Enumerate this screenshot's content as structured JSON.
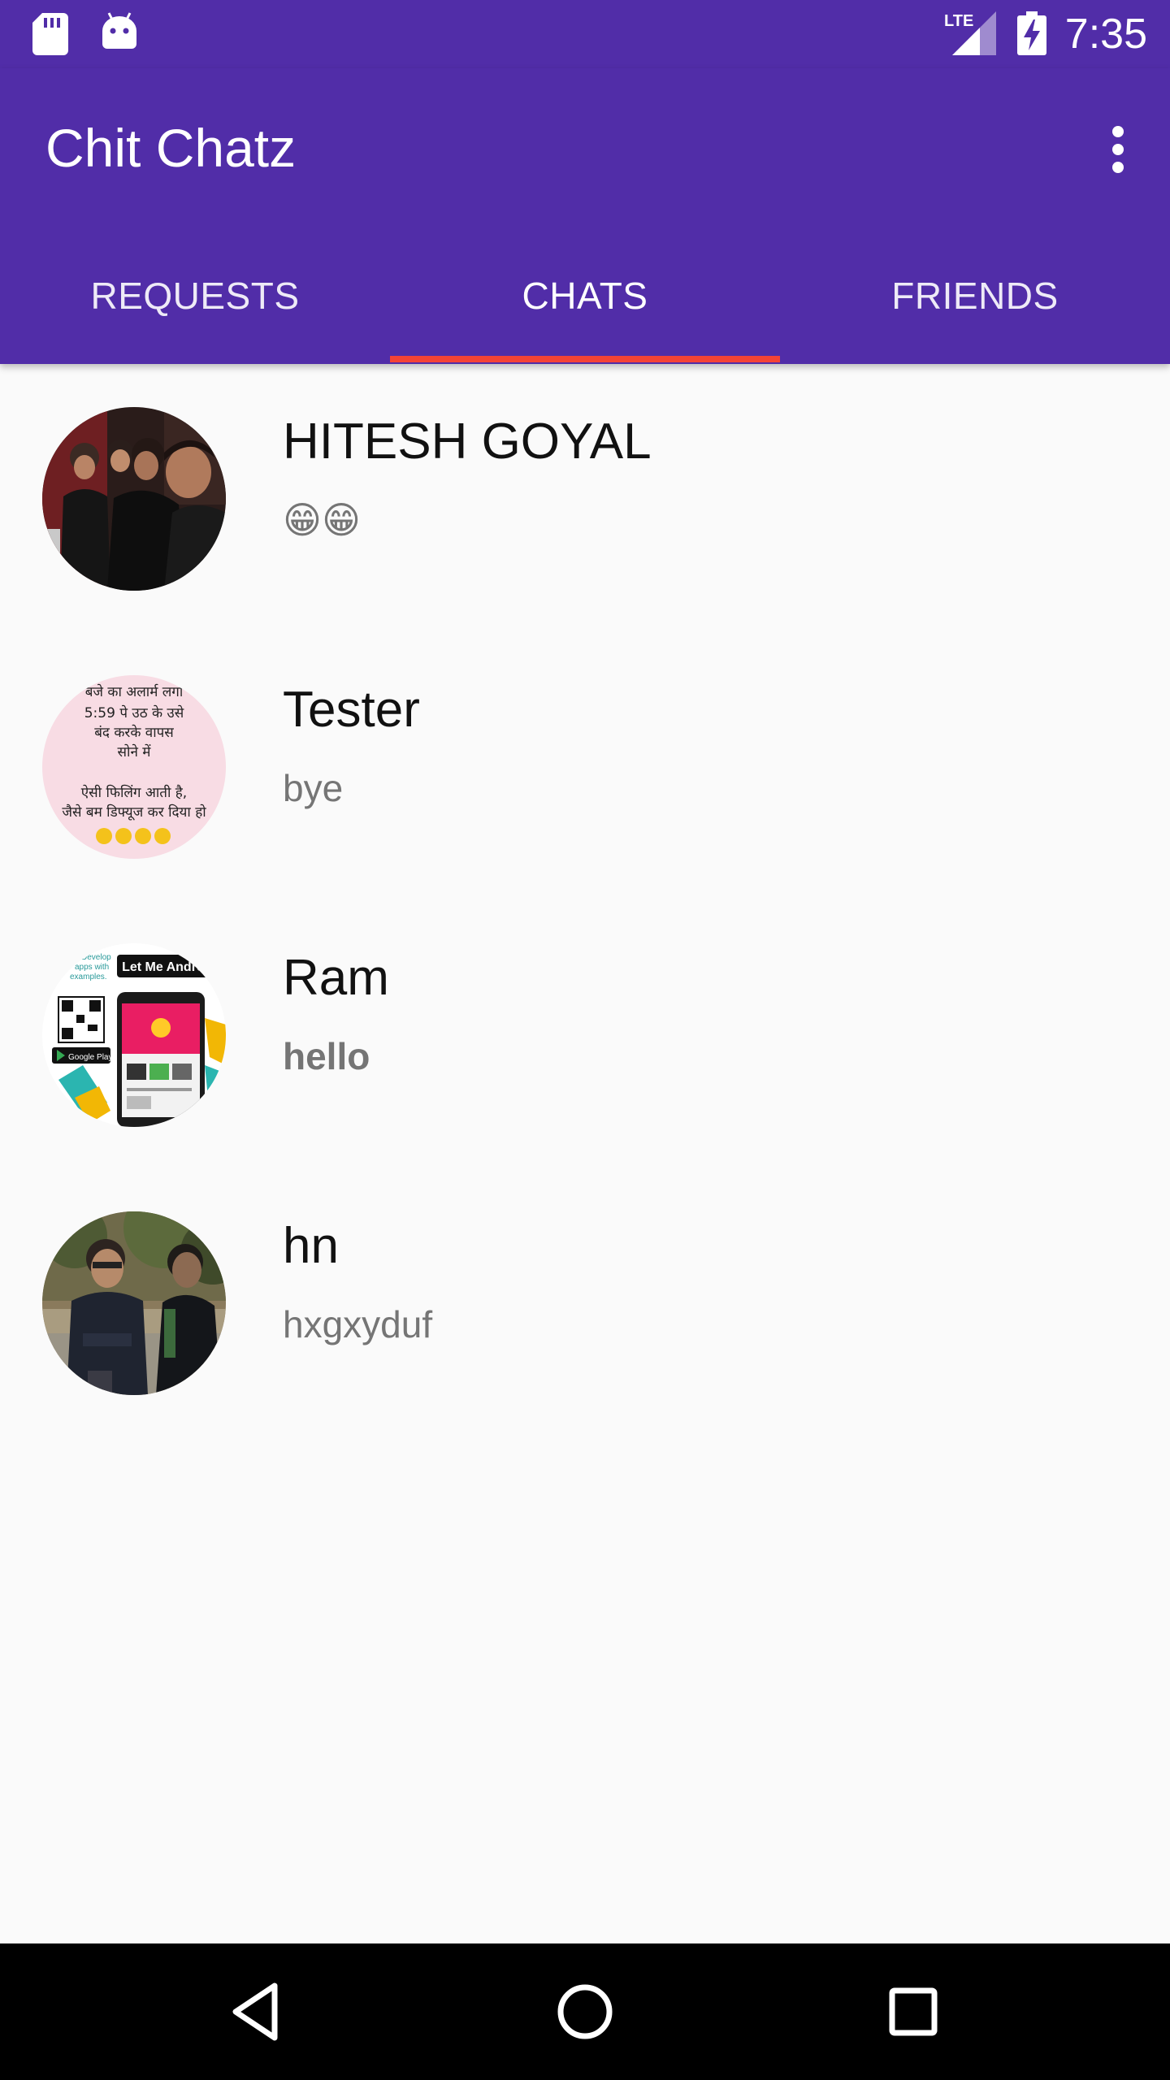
{
  "status_bar": {
    "time": "7:35",
    "network": "LTE",
    "icons": [
      "sd-card-icon",
      "android-icon",
      "lte-signal-icon",
      "battery-charging-icon"
    ]
  },
  "app_bar": {
    "title": "Chit Chatz",
    "menu_icon": "more-vert-icon"
  },
  "tabs": [
    {
      "label": "REQUESTS",
      "active": false
    },
    {
      "label": "CHATS",
      "active": true
    },
    {
      "label": "FRIENDS",
      "active": false
    }
  ],
  "colors": {
    "primary": "#512da8",
    "tab_indicator": "#f44336",
    "background": "#fafafa"
  },
  "chats": [
    {
      "name": "HITESH GOYAL",
      "message": "😁😁",
      "unread": false,
      "avatar": "group-photo"
    },
    {
      "name": "Tester",
      "message": "bye",
      "unread": false,
      "avatar": "hindi-text-meme"
    },
    {
      "name": "Ram",
      "message": "hello",
      "unread": true,
      "avatar": "let-me-android-logo"
    },
    {
      "name": "hn",
      "message": "hxgxyduf",
      "unread": false,
      "avatar": "outdoor-photo"
    }
  ],
  "avatar_texts": {
    "tester": [
      "बजे का अलार्म लगा",
      "5:59 पे उठ के उसे",
      "बंद करके वापस",
      "सोने में",
      "ऐसी फिलिंग आती है,",
      "जैसे बम डिफ्यूज कर दिया हो"
    ],
    "ram": [
      "Let Me Android",
      "Develop",
      "apps with",
      "examples.",
      "Google Play"
    ]
  },
  "nav_bar": {
    "icons": [
      "back-icon",
      "home-icon",
      "recents-icon"
    ]
  }
}
